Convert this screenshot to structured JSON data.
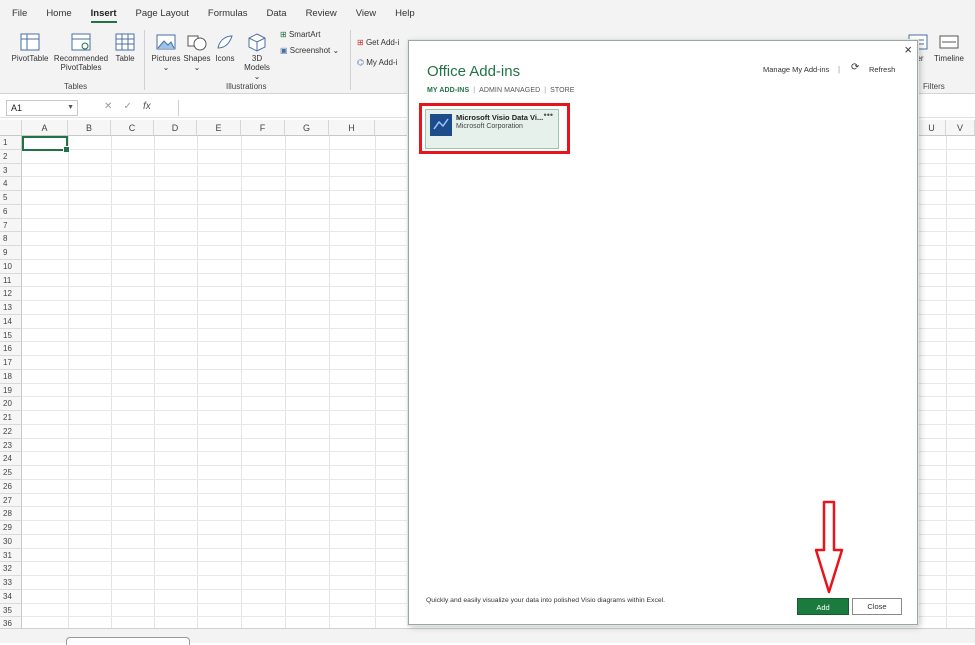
{
  "menu": {
    "items": [
      "File",
      "Home",
      "Insert",
      "Page Layout",
      "Formulas",
      "Data",
      "Review",
      "View",
      "Help"
    ],
    "active": "Insert"
  },
  "ribbon": {
    "pivottable": "PivotTable",
    "recommended_line1": "Recommended",
    "recommended_line2": "PivotTables",
    "table": "Table",
    "tables_group": "Tables",
    "pictures": "Pictures",
    "shapes": "Shapes",
    "icons": "Icons",
    "models_line1": "3D",
    "models_line2": "Models",
    "illustrations_group": "Illustrations",
    "smartart": "SmartArt",
    "screenshot": "Screenshot",
    "get_addins": "Get Add-i",
    "my_addins": "My Add-i",
    "slicer_partial": "cer",
    "timeline": "Timeline",
    "filters_group": "Filters"
  },
  "formula_bar": {
    "name_box": "A1",
    "fx": "fx"
  },
  "grid": {
    "columns_left": [
      "A",
      "B",
      "C",
      "D",
      "E",
      "F",
      "G",
      "H"
    ],
    "columns_right": [
      "U",
      "V"
    ],
    "rows": [
      "1",
      "2",
      "3",
      "4",
      "5",
      "6",
      "7",
      "8",
      "9",
      "10",
      "11",
      "12",
      "13",
      "14",
      "15",
      "16",
      "17",
      "18",
      "19",
      "20",
      "21",
      "22",
      "23",
      "24",
      "25",
      "26",
      "27",
      "28",
      "29",
      "30",
      "31",
      "32",
      "33",
      "34",
      "35",
      "36"
    ]
  },
  "dialog": {
    "title": "Office Add-ins",
    "manage_link": "Manage My Add-ins",
    "refresh": "Refresh",
    "tabs": [
      "MY ADD-INS",
      "ADMIN MANAGED",
      "STORE"
    ],
    "addin": {
      "name": "Microsoft Visio Data Vi...",
      "publisher": "Microsoft Corporation",
      "more": "•••"
    },
    "description": "Quickly and easily visualize your data into polished Visio diagrams within Excel.",
    "add_button": "Add",
    "close_button": "Close"
  },
  "colors": {
    "excel_green": "#217346",
    "highlight_red": "#e8141c",
    "add_button": "#1b7a3e"
  }
}
